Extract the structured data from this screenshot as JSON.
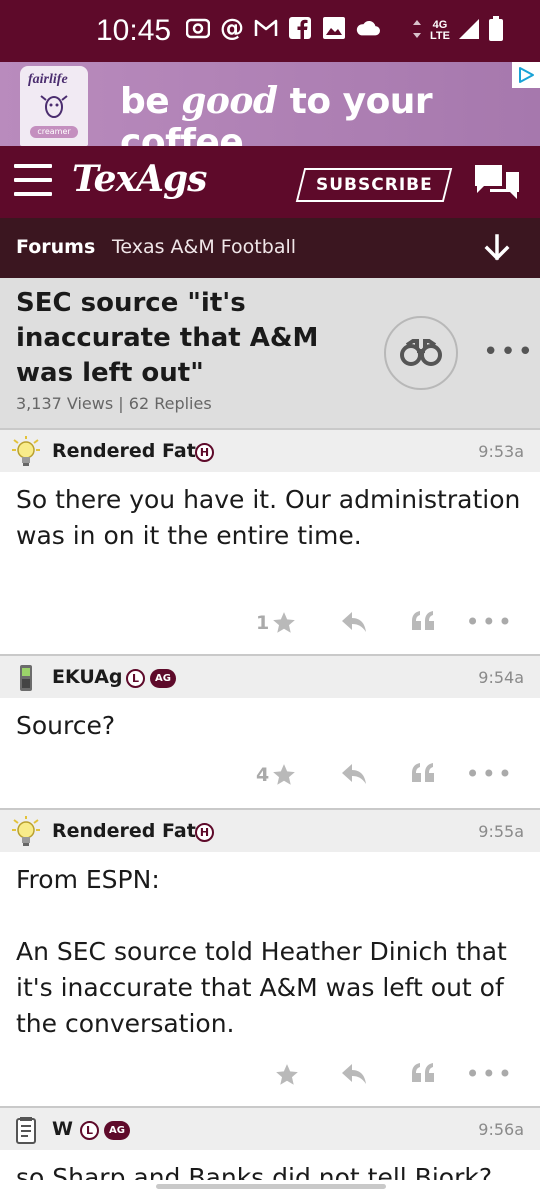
{
  "status": {
    "time": "10:45",
    "network_top": "4G",
    "network_bottom": "LTE"
  },
  "ad": {
    "brand": "fairlife",
    "product_tag": "creamer",
    "headline_pre": "be ",
    "headline_em": "good",
    "headline_post": " to your coffee"
  },
  "header": {
    "logo": "TexAgs",
    "subscribe_label": "SUBSCRIBE"
  },
  "breadcrumb": {
    "forums": "Forums",
    "board": "Texas A&M Football"
  },
  "thread": {
    "title": "SEC source \"it's inaccurate that A&M was left out\"",
    "meta": "3,137 Views | 62 Replies"
  },
  "posts": [
    {
      "user": "Rendered Fat",
      "badges": [
        "H"
      ],
      "time": "9:53a",
      "body": "So there you have it. Our administration was in on it the entire time.",
      "stars": "1"
    },
    {
      "user": "EKUAg",
      "badges": [
        "L",
        "AG"
      ],
      "time": "9:54a",
      "body": "Source?",
      "stars": "4"
    },
    {
      "user": "Rendered Fat",
      "badges": [
        "H"
      ],
      "time": "9:55a",
      "body": "From ESPN:\n\nAn SEC source told Heather Dinich that it's inaccurate that A&M was left out of the conversation.",
      "stars": ""
    },
    {
      "user": "W",
      "badges": [
        "L",
        "AG"
      ],
      "time": "9:56a",
      "body": "so Sharp and Banks did not tell Bjork?"
    }
  ],
  "colors": {
    "maroon": "#5e0a2a",
    "crumb_bg": "#3b1620",
    "thread_bg": "#dedede",
    "post_head_bg": "#eeeeee"
  }
}
